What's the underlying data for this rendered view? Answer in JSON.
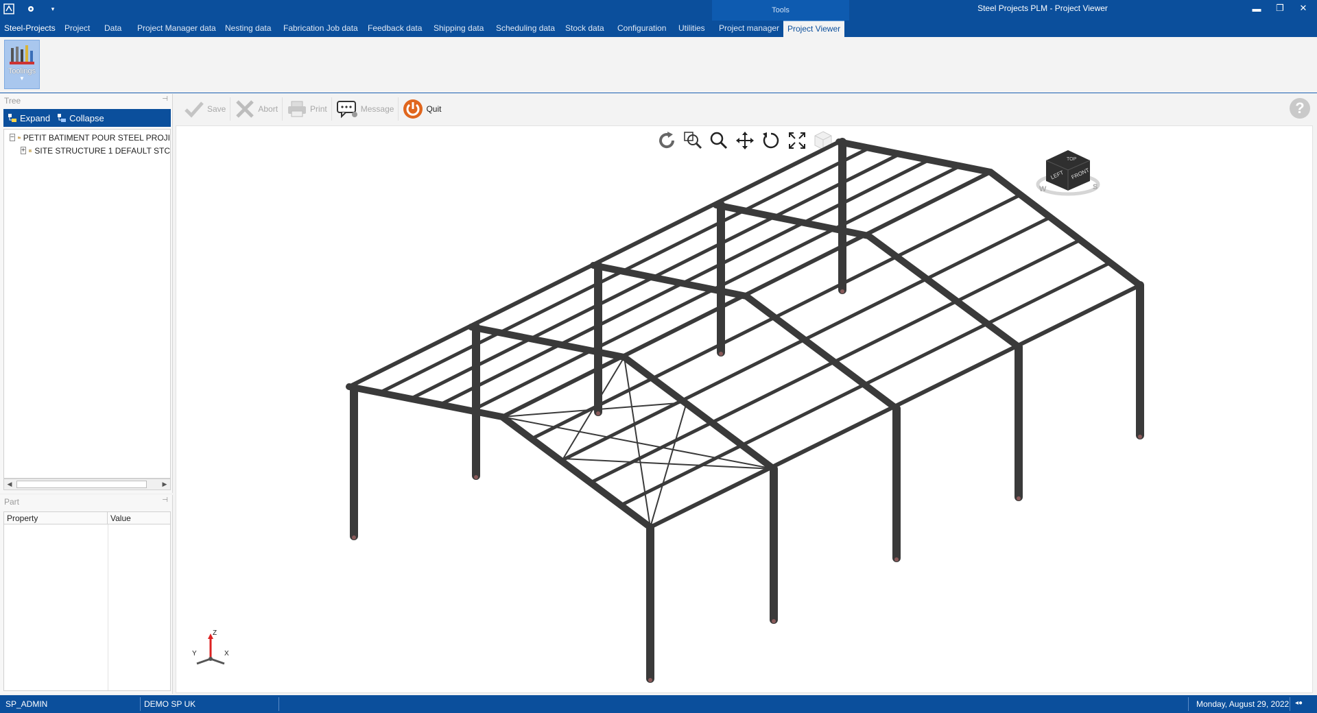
{
  "window": {
    "title": "Steel Projects PLM - Project Viewer",
    "contextual_group": "Tools"
  },
  "menu": {
    "items": [
      {
        "label": "Steel-Projects"
      },
      {
        "label": "Project"
      },
      {
        "label": "Data"
      },
      {
        "label": "Project Manager data"
      },
      {
        "label": "Nesting data"
      },
      {
        "label": "Fabrication Job data"
      },
      {
        "label": "Feedback data"
      },
      {
        "label": "Shipping data"
      },
      {
        "label": "Scheduling data"
      },
      {
        "label": "Stock data"
      },
      {
        "label": "Configuration"
      },
      {
        "label": "Utilities"
      },
      {
        "label": "Project manager"
      },
      {
        "label": "Project Viewer"
      }
    ],
    "active": "Project Viewer"
  },
  "ribbon": {
    "toolings_label": "Toolings"
  },
  "tree_panel": {
    "title": "Tree",
    "expand_label": "Expand",
    "collapse_label": "Collapse",
    "nodes": [
      {
        "label": "PETIT BATIMENT POUR STEEL PROJI",
        "expander": "−",
        "icon": "folder-icon"
      },
      {
        "label": "SITE STRUCTURE 1 DEFAULT STC",
        "expander": "+",
        "icon": "structure-icon"
      }
    ]
  },
  "part_panel": {
    "title": "Part",
    "columns": [
      "Property",
      "Value"
    ]
  },
  "toolbar": {
    "save_label": "Save",
    "abort_label": "Abort",
    "print_label": "Print",
    "message_label": "Message",
    "quit_label": "Quit",
    "help_label": "?"
  },
  "view_tools": [
    "refresh-icon",
    "zoom-window-icon",
    "zoom-icon",
    "pan-icon",
    "rotate-icon",
    "fit-icon",
    "view-cube-icon"
  ],
  "view_cube": {
    "top": "TOP",
    "left": "LEFT",
    "front": "FRONT",
    "compass_w": "W",
    "compass_s": "S"
  },
  "axes": {
    "z": "Z",
    "y": "Y",
    "x": "X"
  },
  "status": {
    "user": "SP_ADMIN",
    "company": "DEMO SP UK",
    "date": "Monday, August 29, 2022"
  },
  "colors": {
    "brand_blue": "#0b4f9c",
    "steel": "#3a3a3a",
    "quit_orange": "#e0661d"
  }
}
